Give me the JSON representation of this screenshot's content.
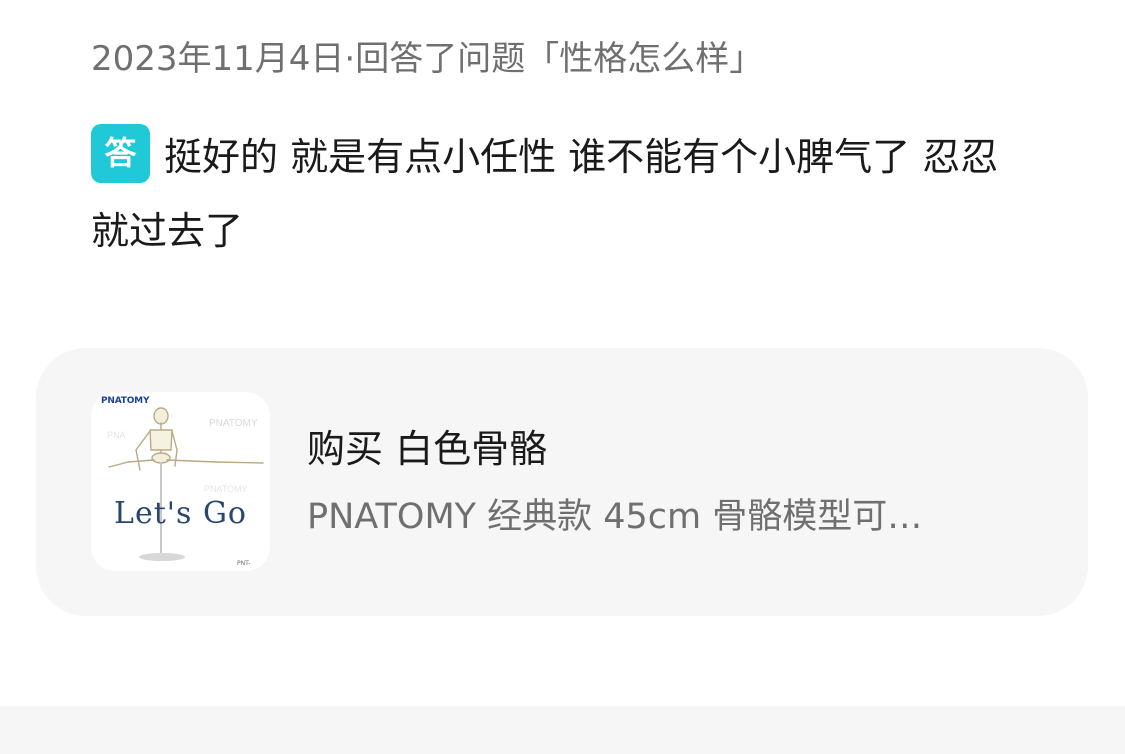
{
  "meta": {
    "text": "2023年11月4日·回答了问题「性格怎么样」"
  },
  "answer": {
    "badge": "答",
    "text": "挺好的 就是有点小任性 谁不能有个小脾气了 忍忍就过去了"
  },
  "product": {
    "title": "购买 白色骨骼",
    "subtitle": "PNATOMY 经典款 45cm 骨骼模型可…",
    "thumbnail": {
      "brand": "PNATOMY",
      "caption": "Let's Go",
      "code": "PNT-"
    }
  },
  "colors": {
    "badge": "#1fc9d8",
    "card_background": "#f6f6f6",
    "primary_text": "#1a1a1a",
    "secondary_text": "#6f6f6f"
  }
}
